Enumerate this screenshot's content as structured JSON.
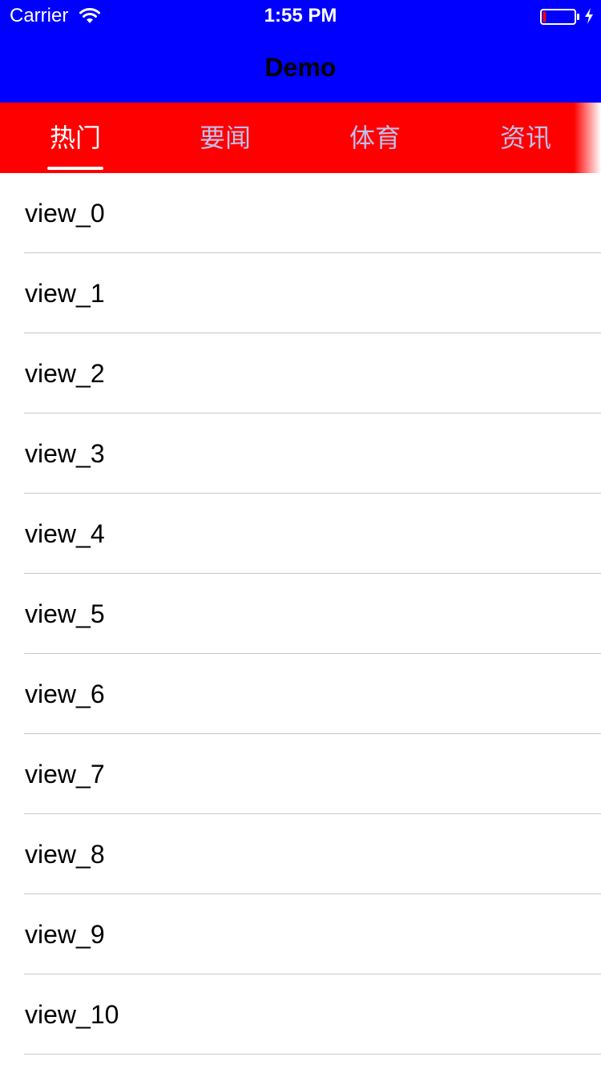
{
  "status_bar": {
    "carrier": "Carrier",
    "time": "1:55 PM",
    "wifi_icon": "wifi-icon",
    "battery_icon": "battery-low-icon",
    "charging_icon": "charging-bolt-icon",
    "battery_level": 0.1,
    "battery_color": "#ff0000"
  },
  "nav": {
    "title": "Demo",
    "background": "#0000ff"
  },
  "tabs": {
    "background": "#ff0000",
    "selected_color": "#ffffff",
    "unselected_color": "#c0c0e8",
    "selected_index": 0,
    "items": [
      {
        "label": "热门"
      },
      {
        "label": "要闻"
      },
      {
        "label": "体育"
      },
      {
        "label": "资讯"
      }
    ]
  },
  "list": {
    "items": [
      "view_0",
      "view_1",
      "view_2",
      "view_3",
      "view_4",
      "view_5",
      "view_6",
      "view_7",
      "view_8",
      "view_9",
      "view_10"
    ]
  }
}
